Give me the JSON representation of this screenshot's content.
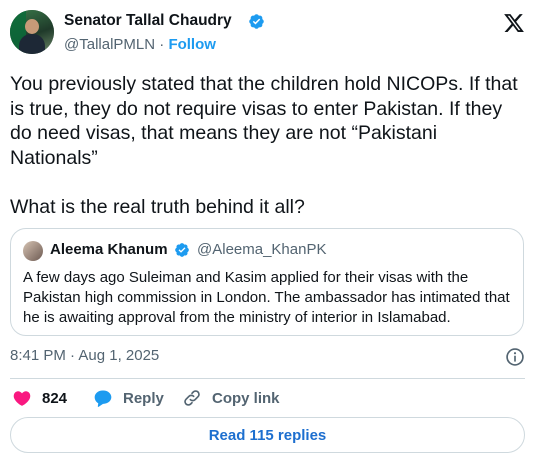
{
  "author": {
    "name": "Senator Tallal Chaudry",
    "handle": "@TallalPMLN",
    "separator": "·",
    "follow_label": "Follow"
  },
  "tweet": {
    "paragraph1": "You previously stated that the children hold NICOPs. If that is true, they do not require visas to enter Pakistan. If they do need visas, that means they are not “Pakistani Nationals”",
    "paragraph2": "What is the real truth behind it all?"
  },
  "quote": {
    "name": "Aleema Khanum",
    "handle": "@Aleema_KhanPK",
    "text": "A few days ago Suleiman and Kasim applied for their visas with the Pakistan high commission in London. The ambassador has intimated that he is awaiting approval from the ministry of interior in Islamabad."
  },
  "meta": {
    "timestamp": "8:41 PM · Aug 1, 2025"
  },
  "actions": {
    "like_count": "824",
    "reply_label": "Reply",
    "copy_label": "Copy link"
  },
  "read_replies_label": "Read 115 replies",
  "colors": {
    "accent": "#1d9bf0",
    "like": "#f91880",
    "text": "#0f1419",
    "muted": "#536471",
    "border": "#cfd9de"
  },
  "icons": [
    "verified-badge-icon",
    "x-logo-icon",
    "info-icon",
    "heart-icon",
    "reply-bubble-icon",
    "link-icon"
  ]
}
